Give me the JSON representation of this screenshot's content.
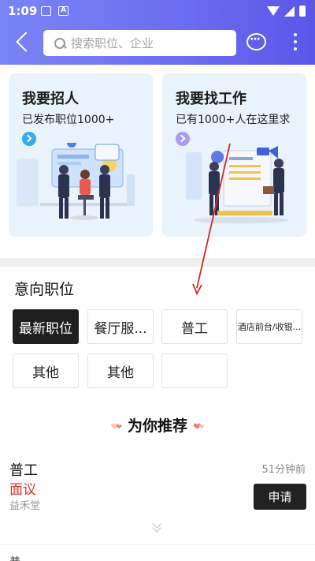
{
  "status_bar": {
    "time": "1:09",
    "icon_a": "A"
  },
  "header": {
    "search_placeholder": "搜索职位、企业"
  },
  "cards": [
    {
      "title": "我要招人",
      "subtitle": "已发布职位1000+",
      "accent": "#3aa9f0"
    },
    {
      "title": "我要找工作",
      "subtitle": "已有1000+人在这里求",
      "accent": "#a89cf0"
    }
  ],
  "intent": {
    "title": "意向职位",
    "chips": [
      "最新职位",
      "餐厅服...",
      "普工",
      "酒店前台/收银...",
      "其他",
      "其他",
      ""
    ]
  },
  "recommend": {
    "title": "为你推荐"
  },
  "job": {
    "title": "普工",
    "salary": "面议",
    "company": "益禾堂",
    "time": "51分钟前",
    "apply": "申请"
  },
  "partial_next": "普",
  "colors": {
    "header_start": "#7a84f5",
    "header_end": "#5b56e8",
    "salary": "#e0352b",
    "annotation_arrow": "#d62828"
  }
}
